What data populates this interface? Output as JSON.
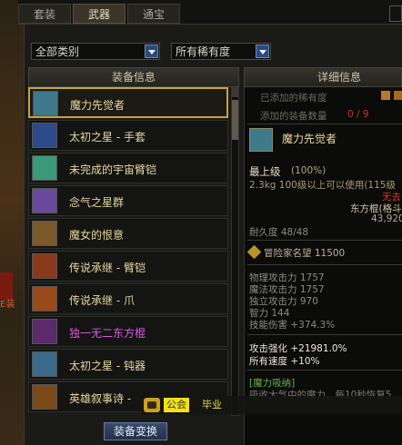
{
  "scenery_text": "E装",
  "tabs": [
    {
      "label": "套装",
      "active": false
    },
    {
      "label": "武器",
      "active": true
    },
    {
      "label": "通宝",
      "active": false
    }
  ],
  "filters": {
    "category": "全部类别",
    "rarity": "所有稀有度"
  },
  "left_header": "装备信息",
  "right_header": "详细信息",
  "items": [
    {
      "name": "魔力先觉者",
      "color": "#ecdc9c",
      "icon_color": "#3e7a8a",
      "selected": true
    },
    {
      "name": "太初之星 - 手套",
      "color": "#e6d7a0",
      "icon_color": "#2d4a8a",
      "selected": false
    },
    {
      "name": "未完成的宇宙臂铠",
      "color": "#e6d7a0",
      "icon_color": "#3a9a7a",
      "selected": false
    },
    {
      "name": "念气之星群",
      "color": "#e6d7a0",
      "icon_color": "#6a4a9a",
      "selected": false
    },
    {
      "name": "魔女的恨意",
      "color": "#e6d7a0",
      "icon_color": "#7a5a2a",
      "selected": false
    },
    {
      "name": "传说承继 - 臂铠",
      "color": "#e6d7a0",
      "icon_color": "#8a3a1a",
      "selected": false
    },
    {
      "name": "传说承继 - 爪",
      "color": "#e6d7a0",
      "icon_color": "#9a4a1a",
      "selected": false
    },
    {
      "name": "独一无二东方棍",
      "color": "#d65ce0",
      "icon_color": "#5a2a6a",
      "selected": false
    },
    {
      "name": "太初之星 - 钝器",
      "color": "#e6d7a0",
      "icon_color": "#3a6a8a",
      "selected": false
    },
    {
      "name": "英雄叙事诗 -",
      "color": "#e6d7a0",
      "icon_color": "#7a4a1a",
      "selected": false
    }
  ],
  "swap_button": "装备变换",
  "detail": {
    "rarity_added_label": "已添加的稀有度",
    "equip_count_label": "添加的装备数量",
    "equip_count_value": "0 / 9",
    "item_name": "魔力先觉者",
    "grade": "最上级",
    "grade_pct": "(100%)",
    "weight_line": "2.3kg  100级以上可以使用(115级",
    "cannot_use": "无去",
    "type": "东方棍(格斗",
    "price": "43,920",
    "durability": "耐久度 48/48",
    "reputation": "冒险家名望 11500",
    "stats": [
      "物理攻击力 1757",
      "魔法攻击力 1757",
      "独立攻击力 970",
      "智力 144",
      "技能伤害 +374.3%"
    ],
    "attack_boost": "攻击强化 +21981.0%",
    "move_speed": "所有速度 +10%",
    "skill_title": "[魔力吸纳]",
    "skill_text": "吸收大气中的魔力，每10秒恢复5"
  },
  "notice": {
    "tag": "公会",
    "name": "毕业"
  }
}
